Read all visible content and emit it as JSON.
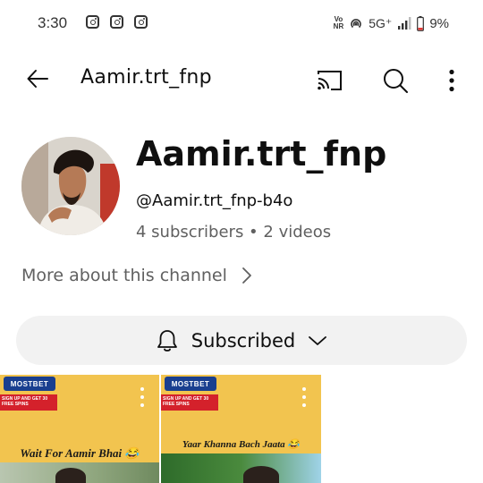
{
  "status_bar": {
    "time": "3:30",
    "volte_line1": "Vo",
    "volte_line2": "NR",
    "network": "5G⁺",
    "battery": "9%"
  },
  "app_bar": {
    "title": "Aamir.trt_fnp",
    "icons": [
      "back-arrow-icon",
      "cast-icon",
      "search-icon",
      "more-vert-icon"
    ]
  },
  "channel": {
    "name": "Aamir.trt_fnp",
    "handle": "@Aamir.trt_fnp-b4o",
    "stats": "4 subscribers • 2 videos",
    "more_about": "More about this channel"
  },
  "subscribe": {
    "label": "Subscribed"
  },
  "videos": [
    {
      "promo_badge": "MOSTBET",
      "promo_text": "SIGN UP AND GET 30 FREE SPINS",
      "caption": "Wait For Aamir Bhai 😂"
    },
    {
      "promo_badge": "MOSTBET",
      "promo_text": "SIGN UP AND GET 30 FREE SPINS",
      "caption": "Yaar Khanna Bach Jaata 😂"
    }
  ],
  "colors": {
    "battery_low": "#e53935",
    "chip_background": "#f2f2f2",
    "secondary_text": "#606060",
    "thumbnail_yellow": "#f2c44f"
  }
}
